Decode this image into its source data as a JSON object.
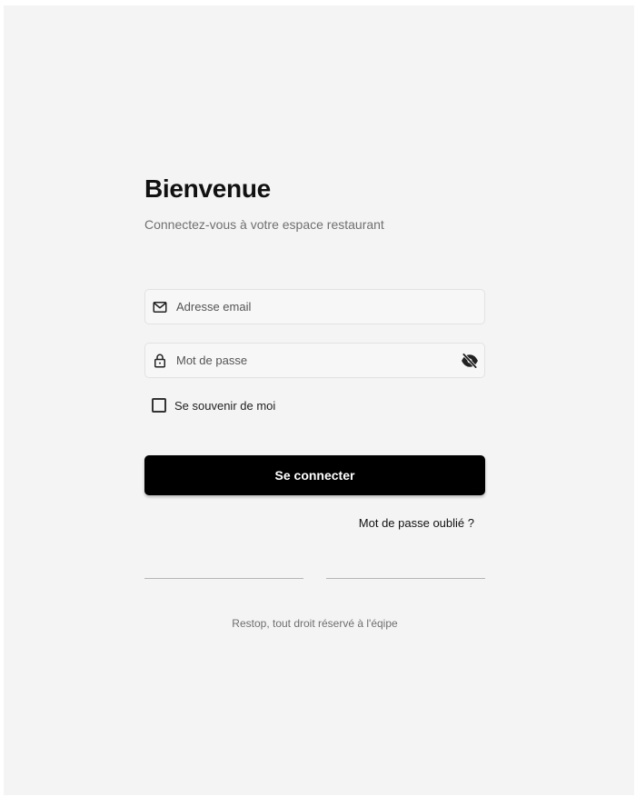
{
  "header": {
    "title": "Bienvenue",
    "subtitle": "Connectez-vous à votre espace restaurant"
  },
  "form": {
    "email": {
      "placeholder": "Adresse email",
      "value": "",
      "icon": "mail-icon"
    },
    "password": {
      "placeholder": "Mot de passe",
      "value": "",
      "icon": "lock-icon",
      "toggle_icon": "eye-off-icon"
    },
    "remember": {
      "label": "Se souvenir de moi",
      "checked": false
    },
    "submit_label": "Se connecter",
    "forgot_label": "Mot de passe oublié ?"
  },
  "footer": {
    "text": "Restop, tout droit réservé à l'éqipe"
  },
  "colors": {
    "background": "#f4f4f4",
    "primary_button": "#000000",
    "primary_button_text": "#ffffff",
    "muted_text": "#707070"
  }
}
